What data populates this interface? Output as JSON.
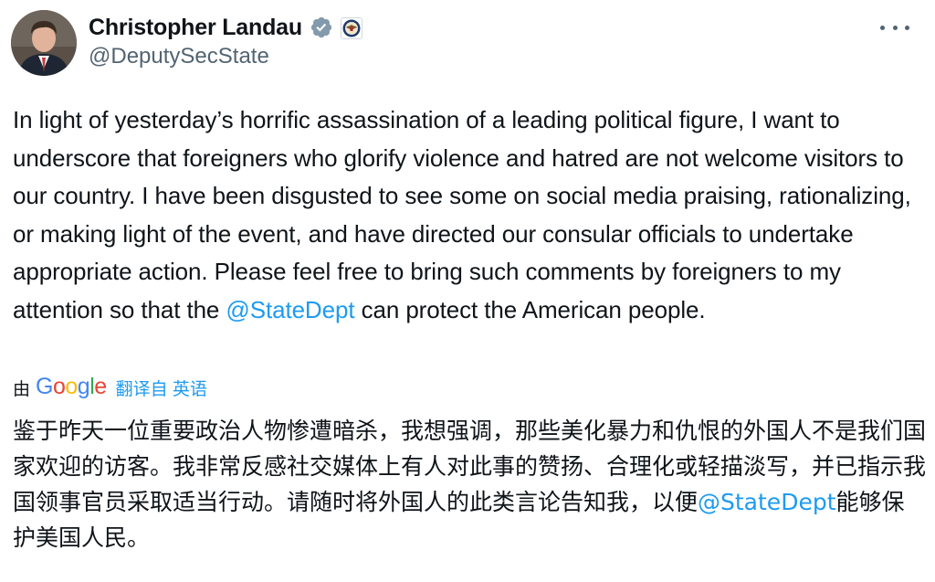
{
  "author": {
    "display_name": "Christopher Landau",
    "handle": "@DeputySecState",
    "verified_icon": "verified-badge-gray",
    "affiliation_icon": "state-department-seal"
  },
  "tweet": {
    "text_part1": "In light of yesterday’s horrific assassination of a leading political figure, I want to underscore that foreigners who glorify violence and hatred are not welcome visitors to our country. I have been disgusted to see some on social media praising, rationalizing, or making light of the event, and have directed our consular officials to undertake appropriate action. Please feel free to bring such comments by foreigners to my attention so that the ",
    "mention": "@StateDept",
    "text_part2": " can protect the American people."
  },
  "translation": {
    "by_label": "由",
    "google_logo": "Google",
    "link_label": "翻译自 英语",
    "text_part1": "鉴于昨天一位重要政治人物惨遭暗杀，我想强调，那些美化暴力和仇恨的外国人不是我们国家欢迎的访客。我非常反感社交媒体上有人对此事的赞扬、合理化或轻描淡写，并已指示我国领事官员采取适当行动。请随时将外国人的此类言论告知我，以便",
    "mention": "@StateDept",
    "text_part2": "能够保护美国人民。"
  },
  "colors": {
    "text": "#0f1419",
    "secondary": "#536471",
    "link": "#1d9bf0"
  },
  "icons": {
    "more": "more-horizontal-icon"
  }
}
